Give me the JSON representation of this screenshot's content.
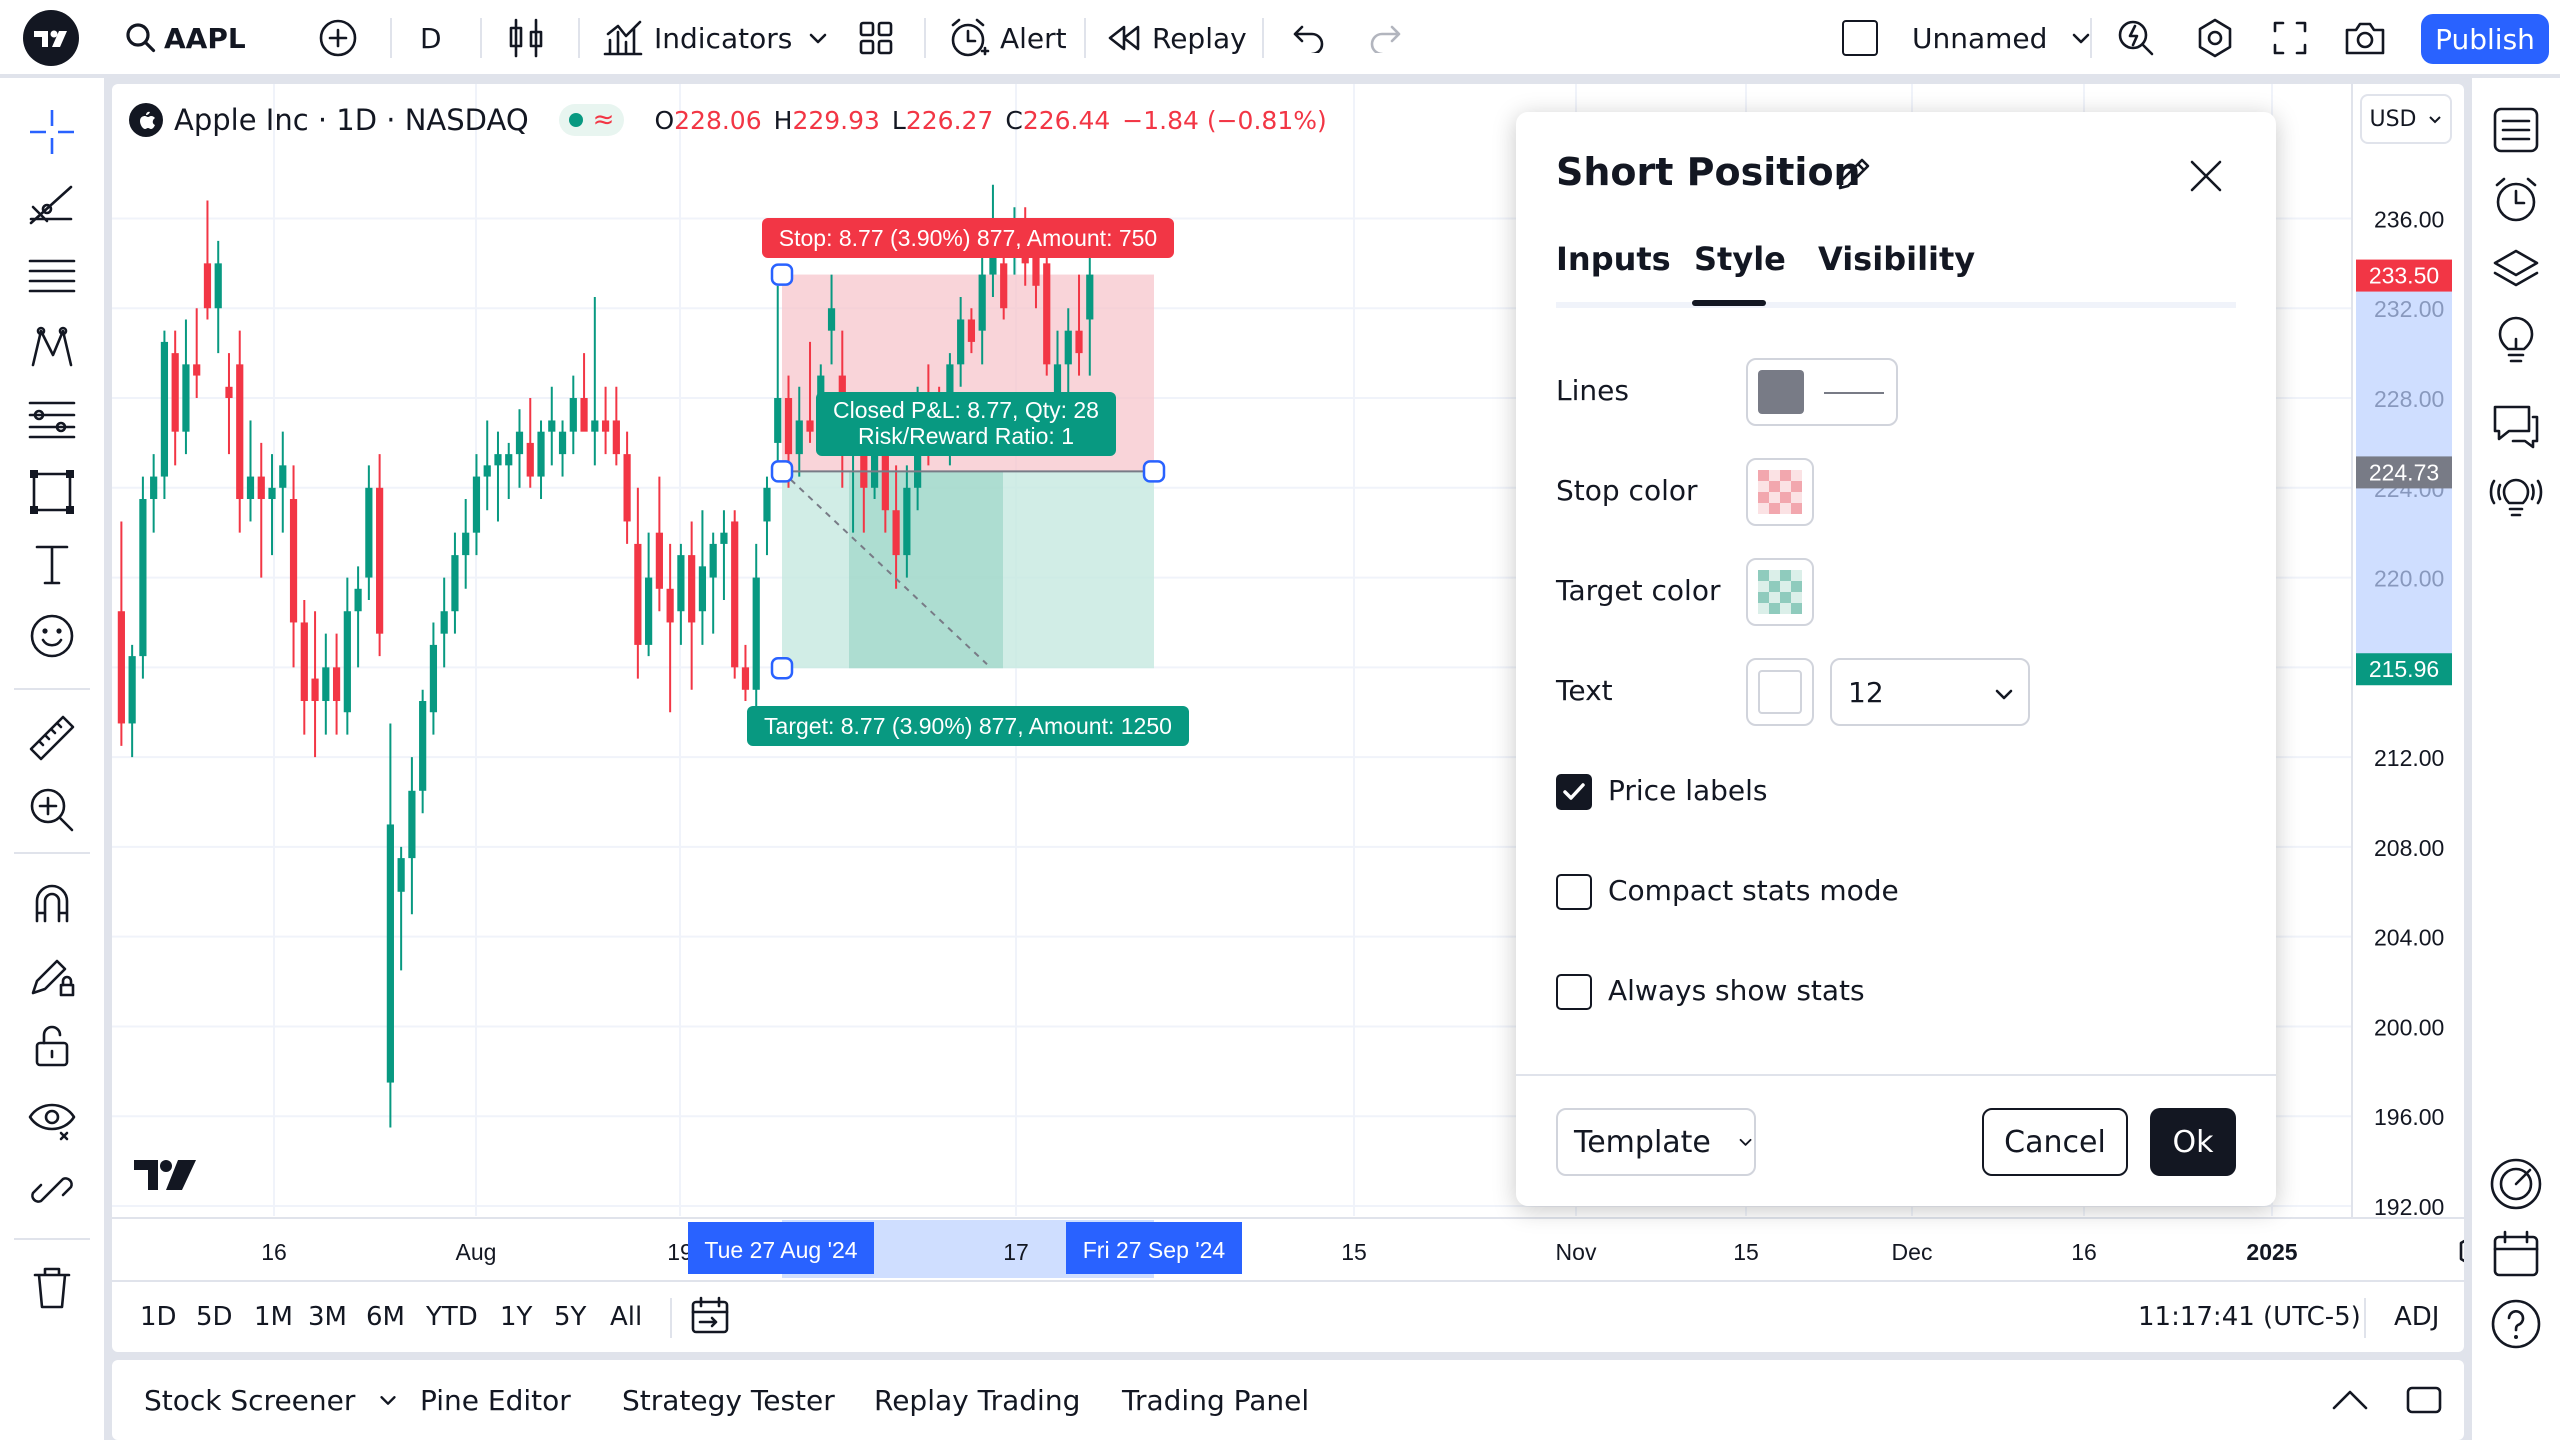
{
  "topbar": {
    "symbol": "AAPL",
    "interval": "D",
    "indicators_label": "Indicators",
    "alert_label": "Alert",
    "replay_label": "Replay",
    "layout_name": "Unnamed",
    "publish_label": "Publish"
  },
  "legend": {
    "title": "Apple Inc · 1D · NASDAQ",
    "open_label": "O",
    "open": "228.06",
    "high_label": "H",
    "high": "229.93",
    "low_label": "L",
    "low": "226.27",
    "close_label": "C",
    "close": "226.44",
    "change": "−1.84 (−0.81%)",
    "currency": "USD"
  },
  "position": {
    "stop_label": "Stop: 8.77 (3.90%) 877, Amount: 750",
    "target_label": "Target: 8.77 (3.90%) 877, Amount: 1250",
    "pnl_line1": "Closed P&L: 8.77, Qty: 28",
    "pnl_line2": "Risk/Reward Ratio: 1"
  },
  "price_axis": {
    "ticks": [
      "236.00",
      "232.00",
      "228.00",
      "224.00",
      "220.00",
      "216.00",
      "212.00",
      "208.00",
      "204.00",
      "200.00",
      "196.00",
      "192.00"
    ],
    "last_price_label": "233.50",
    "entry_label": "224.73",
    "target_price_label": "215.96"
  },
  "time_axis": {
    "ticks": [
      "16",
      "Aug",
      "19",
      "17",
      "15",
      "Nov",
      "15",
      "Dec",
      "16",
      "2025"
    ],
    "start_label": "Tue 27 Aug '24",
    "end_label": "Fri 27 Sep '24"
  },
  "range_bar": {
    "ranges": [
      "1D",
      "5D",
      "1M",
      "3M",
      "6M",
      "YTD",
      "1Y",
      "5Y",
      "All"
    ],
    "clock": "11:17:41 (UTC-5)",
    "adj": "ADJ"
  },
  "bottom_tabs": [
    "Stock Screener",
    "Pine Editor",
    "Strategy Tester",
    "Replay Trading",
    "Trading Panel"
  ],
  "dialog": {
    "title": "Short Position",
    "tabs": [
      "Inputs",
      "Style",
      "Visibility"
    ],
    "active_tab": "Style",
    "lines_label": "Lines",
    "stop_color_label": "Stop color",
    "target_color_label": "Target color",
    "text_label": "Text",
    "font_size": "12",
    "price_labels": "Price labels",
    "compact_stats": "Compact stats mode",
    "always_show_stats": "Always show stats",
    "template_label": "Template",
    "cancel_label": "Cancel",
    "ok_label": "Ok",
    "price_labels_checked": true,
    "compact_checked": false,
    "always_checked": false
  },
  "colors": {
    "up": "#089981",
    "down": "#f23645",
    "accent": "#2962ff",
    "stop_fill": "#f7c6cc",
    "target_fill": "#c5e8e0",
    "line_color": "#787b86"
  },
  "chart_data": {
    "type": "candlestick",
    "symbol": "AAPL",
    "interval": "1D",
    "ylim": [
      191,
      239
    ],
    "candles": [
      [
        218.5,
        222.5,
        212.5,
        213.5
      ],
      [
        213.5,
        217.0,
        212.0,
        216.5
      ],
      [
        216.5,
        224.5,
        215.5,
        223.5
      ],
      [
        223.5,
        225.5,
        222.0,
        224.5
      ],
      [
        224.5,
        231.0,
        223.5,
        230.5
      ],
      [
        230.0,
        231.0,
        225.0,
        226.5
      ],
      [
        226.5,
        231.5,
        225.5,
        229.5
      ],
      [
        229.5,
        232.0,
        228.0,
        229.0
      ],
      [
        234.0,
        236.8,
        231.5,
        232.0
      ],
      [
        232.0,
        235.0,
        230.0,
        234.0
      ],
      [
        228.5,
        230.0,
        225.5,
        228.0
      ],
      [
        229.5,
        231.0,
        222.0,
        223.5
      ],
      [
        223.5,
        227.0,
        222.5,
        224.5
      ],
      [
        224.5,
        226.0,
        220.0,
        223.5
      ],
      [
        223.5,
        225.5,
        221.0,
        224.0
      ],
      [
        224.0,
        226.5,
        222.0,
        225.0
      ],
      [
        223.5,
        225.0,
        216.0,
        218.0
      ],
      [
        218.0,
        219.0,
        213.0,
        214.5
      ],
      [
        215.5,
        218.5,
        212.0,
        214.5
      ],
      [
        214.5,
        217.5,
        213.0,
        216.0
      ],
      [
        216.0,
        217.5,
        213.0,
        214.5
      ],
      [
        214.0,
        220.0,
        213.0,
        218.5
      ],
      [
        218.5,
        220.5,
        216.0,
        219.5
      ],
      [
        220.0,
        225.0,
        219.0,
        224.0
      ],
      [
        224.0,
        225.5,
        216.5,
        217.5
      ],
      [
        197.5,
        213.5,
        195.5,
        209.0
      ],
      [
        206.0,
        208.0,
        202.5,
        207.5
      ],
      [
        207.5,
        212.0,
        205.0,
        210.5
      ],
      [
        210.5,
        215.0,
        209.5,
        214.5
      ],
      [
        214.0,
        218.0,
        213.0,
        217.0
      ],
      [
        217.5,
        220.0,
        216.0,
        218.5
      ],
      [
        218.5,
        222.0,
        217.5,
        221.0
      ],
      [
        221.0,
        223.5,
        219.5,
        222.0
      ],
      [
        222.0,
        225.5,
        221.0,
        224.5
      ],
      [
        224.5,
        227.0,
        223.0,
        225.0
      ],
      [
        225.0,
        226.5,
        222.5,
        225.5
      ],
      [
        225.0,
        226.0,
        223.5,
        225.5
      ],
      [
        225.5,
        227.5,
        224.0,
        226.5
      ],
      [
        226.0,
        228.0,
        224.0,
        224.5
      ],
      [
        224.5,
        227.0,
        223.5,
        226.5
      ],
      [
        226.5,
        228.5,
        225.0,
        227.0
      ],
      [
        225.5,
        227.0,
        224.5,
        226.5
      ],
      [
        226.5,
        229.0,
        225.5,
        228.0
      ],
      [
        228.0,
        230.0,
        227.0,
        226.5
      ],
      [
        226.5,
        232.5,
        225.0,
        227.0
      ],
      [
        227.0,
        228.5,
        225.5,
        226.5
      ],
      [
        227.0,
        228.5,
        225.0,
        225.5
      ],
      [
        225.5,
        226.5,
        221.5,
        222.5
      ],
      [
        221.5,
        224.0,
        215.5,
        217.0
      ],
      [
        217.0,
        222.0,
        216.5,
        220.0
      ],
      [
        222.0,
        224.5,
        218.5,
        219.5
      ],
      [
        219.5,
        221.5,
        214.0,
        218.0
      ],
      [
        218.5,
        221.5,
        217.0,
        221.0
      ],
      [
        221.0,
        222.5,
        215.0,
        218.0
      ],
      [
        218.5,
        223.0,
        217.0,
        220.5
      ],
      [
        220.0,
        222.0,
        217.5,
        221.5
      ],
      [
        221.5,
        223.0,
        219.0,
        222.0
      ],
      [
        222.5,
        223.0,
        215.5,
        216.0
      ],
      [
        216.0,
        217.0,
        214.5,
        215.0
      ],
      [
        215.0,
        221.5,
        214.0,
        220.0
      ],
      [
        222.5,
        224.5,
        221.0,
        224.0
      ],
      [
        226.0,
        233.0,
        225.0,
        228.0
      ],
      [
        228.0,
        229.0,
        224.0,
        225.5
      ],
      [
        225.5,
        228.5,
        224.5,
        227.0
      ],
      [
        227.0,
        230.5,
        226.0,
        226.5
      ],
      [
        227.0,
        229.5,
        225.5,
        229.0
      ],
      [
        231.0,
        233.5,
        229.5,
        232.0
      ],
      [
        229.0,
        231.0,
        224.0,
        225.5
      ],
      [
        225.5,
        227.5,
        222.0,
        226.5
      ],
      [
        226.5,
        228.0,
        222.0,
        224.0
      ],
      [
        224.0,
        227.5,
        223.5,
        226.0
      ],
      [
        226.5,
        228.0,
        222.0,
        223.0
      ],
      [
        223.0,
        225.0,
        219.5,
        221.0
      ],
      [
        221.0,
        225.0,
        220.0,
        224.0
      ],
      [
        224.0,
        228.5,
        223.0,
        228.0
      ],
      [
        228.0,
        229.5,
        225.0,
        227.5
      ],
      [
        227.5,
        228.5,
        225.5,
        226.5
      ],
      [
        226.0,
        230.0,
        225.0,
        229.5
      ],
      [
        229.5,
        232.5,
        228.5,
        231.5
      ],
      [
        231.5,
        232.0,
        230.0,
        230.5
      ],
      [
        231.0,
        234.5,
        229.5,
        233.5
      ],
      [
        233.5,
        237.5,
        232.5,
        234.5
      ],
      [
        234.0,
        235.0,
        231.5,
        232.0
      ],
      [
        234.5,
        236.5,
        233.5,
        235.5
      ],
      [
        235.5,
        236.5,
        233.0,
        234.0
      ],
      [
        234.5,
        236.0,
        232.0,
        233.0
      ],
      [
        234.0,
        235.5,
        229.0,
        229.5
      ],
      [
        227.5,
        231.0,
        225.5,
        229.5
      ],
      [
        229.5,
        232.0,
        228.0,
        231.0
      ],
      [
        231.0,
        233.5,
        229.0,
        230.0
      ],
      [
        231.5,
        234.5,
        229.0,
        233.5
      ]
    ]
  }
}
